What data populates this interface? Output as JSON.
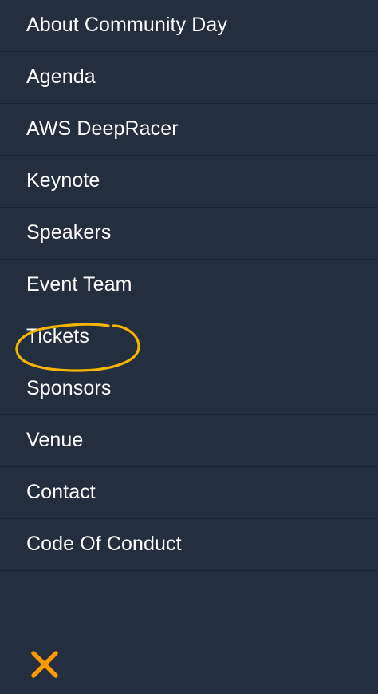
{
  "menu": {
    "items": [
      {
        "id": "about",
        "label": "About Community Day"
      },
      {
        "id": "agenda",
        "label": "Agenda"
      },
      {
        "id": "deepracer",
        "label": "AWS DeepRacer"
      },
      {
        "id": "keynote",
        "label": "Keynote"
      },
      {
        "id": "speakers",
        "label": "Speakers"
      },
      {
        "id": "event-team",
        "label": "Event Team"
      },
      {
        "id": "tickets",
        "label": "Tickets"
      },
      {
        "id": "sponsors",
        "label": "Sponsors"
      },
      {
        "id": "venue",
        "label": "Venue"
      },
      {
        "id": "contact",
        "label": "Contact"
      },
      {
        "id": "code-of-conduct",
        "label": "Code Of Conduct"
      }
    ]
  },
  "close": {
    "icon": "close-icon"
  },
  "colors": {
    "background": "#232f3e",
    "divider": "#1a2431",
    "text": "#ffffff",
    "accent": "#ff9900",
    "annotation": "#f5b400"
  }
}
